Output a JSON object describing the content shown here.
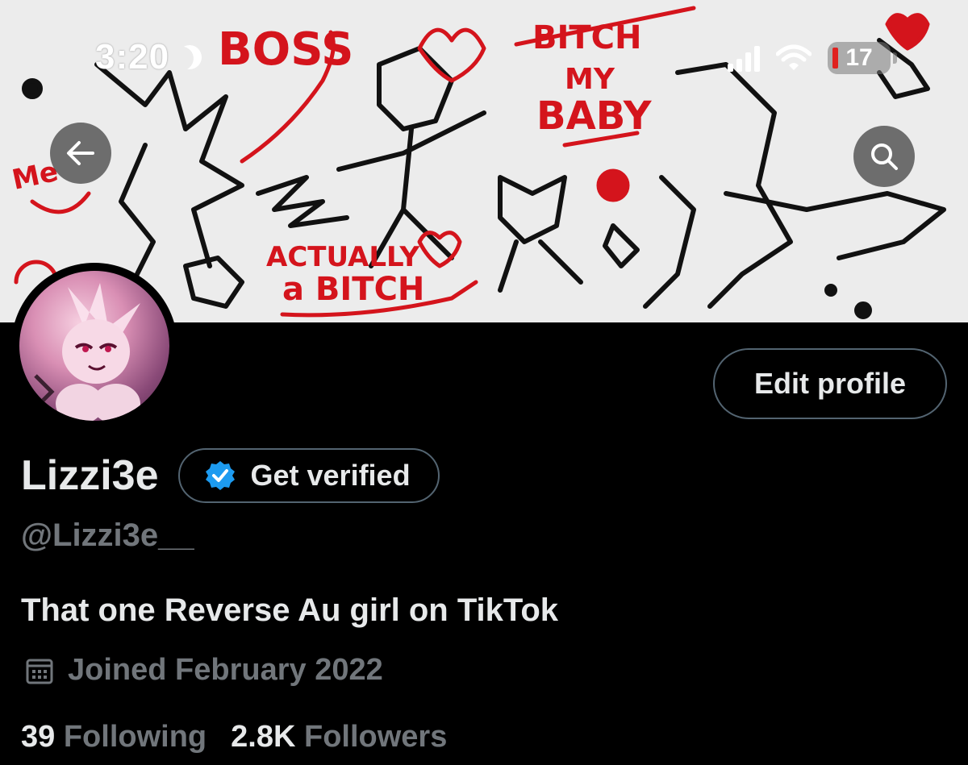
{
  "status_bar": {
    "time": "3:20",
    "battery": "17"
  },
  "banner": {
    "texts": [
      "Me",
      "BOSS",
      "BITCH",
      "MY",
      "BABY",
      "ACTUALLY",
      "a BITCH"
    ]
  },
  "profile": {
    "display_name": "Lizzi3e",
    "handle": "@Lizzi3e__",
    "bio": "That one Reverse Au girl on TikTok",
    "joined": "Joined February 2022",
    "following_count": "39",
    "following_label": "Following",
    "followers_count": "2.8K",
    "followers_label": "Followers"
  },
  "buttons": {
    "edit_profile": "Edit profile",
    "get_verified": "Get verified"
  },
  "colors": {
    "background": "#000000",
    "text_primary": "#e7e9ea",
    "text_secondary": "#71767b",
    "border": "#536471",
    "verified_blue": "#1d9bf0",
    "banner_red": "#d4141c"
  },
  "icons": {
    "back": "arrow-left-icon",
    "search": "search-icon",
    "verified": "verified-badge-icon",
    "calendar": "calendar-icon"
  }
}
